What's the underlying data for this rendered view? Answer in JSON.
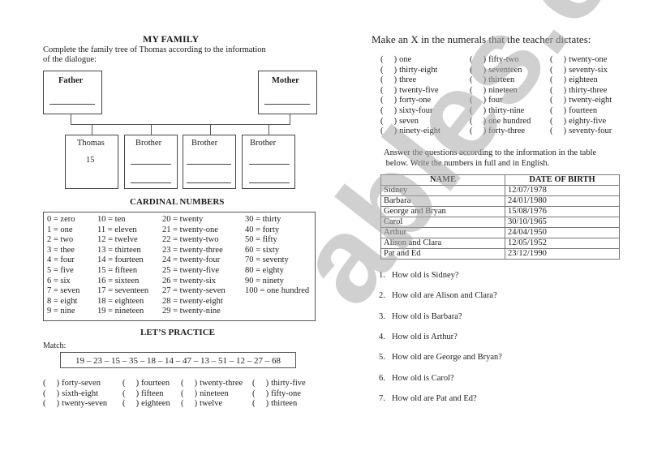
{
  "left": {
    "title": "MY FAMILY",
    "instruction_line1": "Complete the family tree of Thomas according to the information",
    "instruction_line2": "of the dialogue:",
    "tree": {
      "father": "Father",
      "mother": "Mother",
      "children": [
        {
          "label": "Thomas",
          "value": "15"
        },
        {
          "label": "Brother"
        },
        {
          "label": "Brother"
        },
        {
          "label": "Brother"
        }
      ]
    },
    "cardinal_title": "CARDINAL NUMBERS",
    "cardinal_columns": [
      [
        "0 = zero",
        "1 = one",
        "2 = two",
        "3 =  thee",
        "4 = four",
        "5 = five",
        "6 = six",
        "7 = seven",
        "8 = eight",
        "9 = nine"
      ],
      [
        "10 = ten",
        "11 = eleven",
        "12 = twelve",
        "13 = thirteen",
        "14 = fourteen",
        "15 = fifteen",
        "16 = sixteen",
        "17 = seventeen",
        "18 = eighteen",
        "19 = nineteen"
      ],
      [
        "20 = twenty",
        "21 = twenty-one",
        "22 = twenty-two",
        "23 = twenty-three",
        "24 = twenty-four",
        "25 = twenty-five",
        "26 = twenty-six",
        "27 = twenty-seven",
        "28 = twenty-eight",
        "29 = twenty-nine"
      ],
      [
        "30 =  thirty",
        "40 = forty",
        "50 = fifty",
        "60 = sixty",
        "70 = seventy",
        "80 = eighty",
        "90 = ninety",
        "100 = one hundred"
      ]
    ],
    "practice_title": "LET’S PRACTICE",
    "match_label": "Match:",
    "match_numbers": "19 – 23 – 15 – 35 – 18 – 14 – 47 – 13 – 51 – 12 – 27 – 68",
    "match_options": [
      [
        "forty-seven",
        "sixth-eight",
        "twenty-seven"
      ],
      [
        "fourteen",
        "fifteen",
        "eighteen"
      ],
      [
        "twenty-three",
        "nineteen",
        "twelve"
      ],
      [
        "thirty-five",
        "fifty-one",
        "thirteen"
      ]
    ]
  },
  "right": {
    "dictation_title": "Make an X in the numerals that the teacher dictates:",
    "dictation_options": [
      [
        "one",
        "thirty-eight",
        "three",
        "twenty-five",
        "forty-one",
        "sixty-four",
        "seven",
        "ninety-eight"
      ],
      [
        "fifty-two",
        "seventeen",
        "thirteen",
        "nineteen",
        "four",
        "thirty-nine",
        "one hundred",
        "forty-three"
      ],
      [
        "twenty-one",
        "seventy-six",
        "eighteen",
        "thirty-three",
        "twenty-eight",
        "fourteen",
        "eighty-five",
        "seventy-four"
      ]
    ],
    "answer_instruction_line1": "Answer the questions according to the information in the table",
    "answer_instruction_line2": " below. Write the numbers in full and in English.",
    "table": {
      "headers": [
        "NAME",
        "DATE OF BIRTH"
      ],
      "rows": [
        [
          "Sidney",
          "12/07/1978"
        ],
        [
          "Barbara",
          "24/01/1980"
        ],
        [
          "George and Bryan",
          "15/08/1976"
        ],
        [
          "Carol",
          "30/10/1965"
        ],
        [
          "Arthur",
          "24/04/1950"
        ],
        [
          "Alison and Clara",
          "12/05/1952"
        ],
        [
          "Pat and Ed",
          "23/12/1990"
        ]
      ]
    },
    "questions": [
      {
        "n": "1.",
        "text": "How old is Sidney?"
      },
      {
        "n": "2.",
        "text": "How old are Alison and Clara?"
      },
      {
        "n": "3.",
        "text": "How old is Barbara?"
      },
      {
        "n": "4.",
        "text": "How old is Arthur?"
      },
      {
        "n": "5.",
        "text": "How old are George and Bryan?"
      },
      {
        "n": "6.",
        "text": "How old is Carol?"
      },
      {
        "n": "7.",
        "text": "How old are Pat and Ed?"
      }
    ]
  },
  "checkbox_mark": "(     )",
  "watermark": "ables.com"
}
